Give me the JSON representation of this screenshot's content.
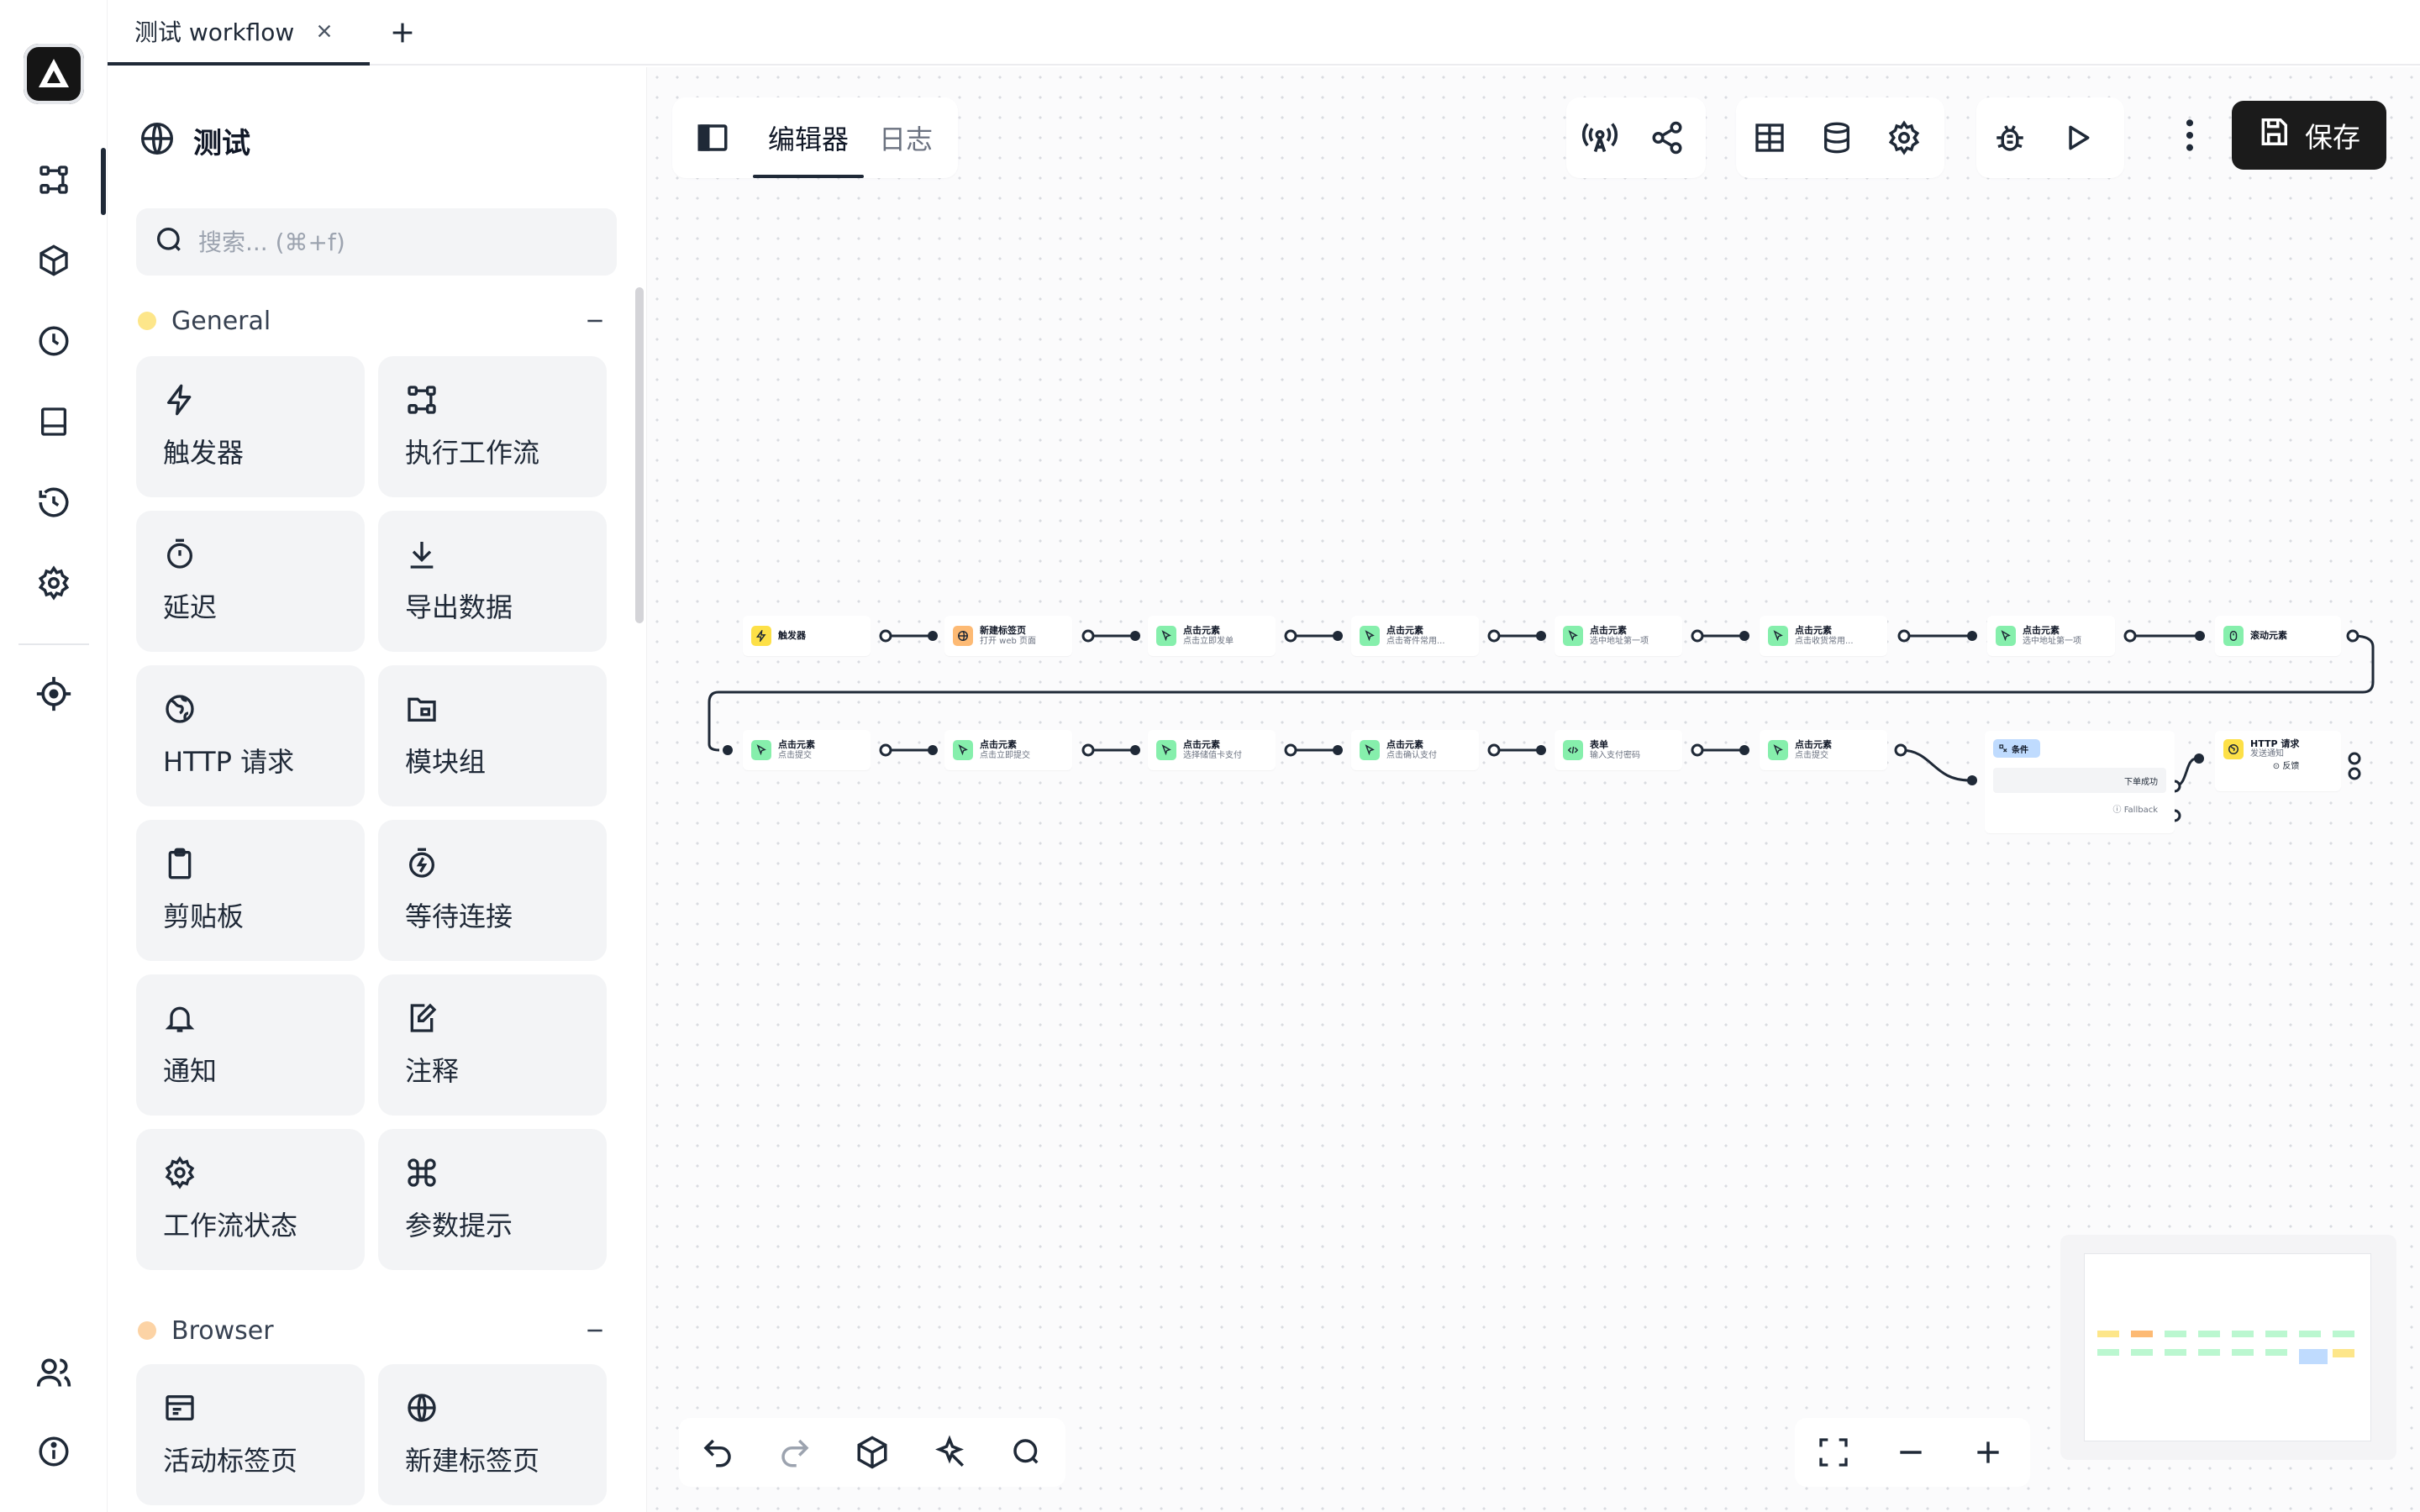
{
  "tabbar": {
    "tabs": [
      {
        "label": "测试 workflow"
      }
    ]
  },
  "rail": {
    "items": [
      {
        "icon": "workflow-icon"
      },
      {
        "icon": "package-icon"
      },
      {
        "icon": "clock-icon"
      },
      {
        "icon": "storage-icon"
      },
      {
        "icon": "history-icon"
      },
      {
        "icon": "gear-icon"
      },
      {
        "icon": "crosshair-icon"
      },
      {
        "icon": "users-icon"
      },
      {
        "icon": "info-icon"
      }
    ]
  },
  "panel": {
    "title": "测试",
    "search": {
      "placeholder": "搜索... (⌘+f)"
    },
    "categories": [
      {
        "name": "General",
        "color": "#fde68a"
      },
      {
        "name": "Browser",
        "color": "#fcd3a5"
      }
    ],
    "blocks": [
      {
        "label": "触发器",
        "icon": "lightning-icon"
      },
      {
        "label": "执行工作流",
        "icon": "workflow-icon"
      },
      {
        "label": "延迟",
        "icon": "timer-icon"
      },
      {
        "label": "导出数据",
        "icon": "download-icon"
      },
      {
        "label": "HTTP 请求",
        "icon": "globe-icon"
      },
      {
        "label": "模块组",
        "icon": "folder-icon"
      },
      {
        "label": "剪贴板",
        "icon": "clipboard-icon"
      },
      {
        "label": "等待连接",
        "icon": "timer-bolt-icon"
      },
      {
        "label": "通知",
        "icon": "bell-icon"
      },
      {
        "label": "注释",
        "icon": "note-icon"
      },
      {
        "label": "工作流状态",
        "icon": "gear-icon"
      },
      {
        "label": "参数提示",
        "icon": "command-icon"
      },
      {
        "label": "活动标签页",
        "icon": "window-icon"
      },
      {
        "label": "新建标签页",
        "icon": "globe-icon"
      }
    ]
  },
  "editor": {
    "tabs": [
      {
        "label": "编辑器"
      },
      {
        "label": "日志"
      }
    ],
    "save_label": "保存"
  },
  "workflow": {
    "nodes": [
      {
        "title": "触发器",
        "subtitle": "",
        "type": "trigger",
        "color": "#fde047"
      },
      {
        "title": "新建标签页",
        "subtitle": "打开 web 页面",
        "type": "new-tab",
        "color": "#fdba74"
      },
      {
        "title": "点击元素",
        "subtitle": "点击立即发单",
        "type": "click",
        "color": "#86efac"
      },
      {
        "title": "点击元素",
        "subtitle": "点击寄件常用...",
        "type": "click",
        "color": "#86efac"
      },
      {
        "title": "点击元素",
        "subtitle": "选中地址第一项",
        "type": "click",
        "color": "#86efac"
      },
      {
        "title": "点击元素",
        "subtitle": "点击收货常用...",
        "type": "click",
        "color": "#86efac"
      },
      {
        "title": "点击元素",
        "subtitle": "选中地址第一项",
        "type": "click",
        "color": "#86efac"
      },
      {
        "title": "滚动元素",
        "subtitle": "",
        "type": "scroll",
        "color": "#86efac"
      },
      {
        "title": "点击元素",
        "subtitle": "点击提交",
        "type": "click",
        "color": "#86efac"
      },
      {
        "title": "点击元素",
        "subtitle": "点击立即提交",
        "type": "click",
        "color": "#86efac"
      },
      {
        "title": "点击元素",
        "subtitle": "选择储值卡支付",
        "type": "click",
        "color": "#86efac"
      },
      {
        "title": "点击元素",
        "subtitle": "点击确认支付",
        "type": "click",
        "color": "#86efac"
      },
      {
        "title": "表单",
        "subtitle": "输入支付密码",
        "type": "form",
        "color": "#86efac"
      },
      {
        "title": "点击元素",
        "subtitle": "点击提交",
        "type": "click",
        "color": "#86efac"
      }
    ],
    "condition": {
      "title": "条件",
      "path": "下单成功",
      "fallback": "ⓘ Fallback",
      "color": "#bfdbfe"
    },
    "http": {
      "title": "HTTP 请求",
      "subtitle": "发送通知",
      "extra": "⊙ 反馈",
      "color": "#fde047"
    }
  }
}
